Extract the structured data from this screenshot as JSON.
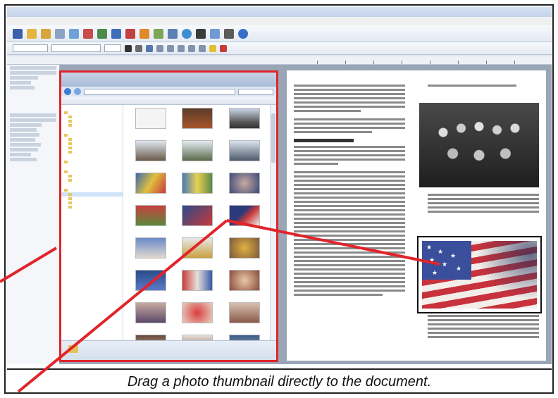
{
  "caption": "Drag a photo thumbnail directly to the document.",
  "colors": {
    "highlight_red": "#e0242a",
    "frame_border": "#222222",
    "window_chrome": "#dfe6f0",
    "flag_blue": "#3a4f9c",
    "flag_red": "#c8323c"
  },
  "icons": {
    "folder": "folder-icon",
    "star": "★"
  }
}
